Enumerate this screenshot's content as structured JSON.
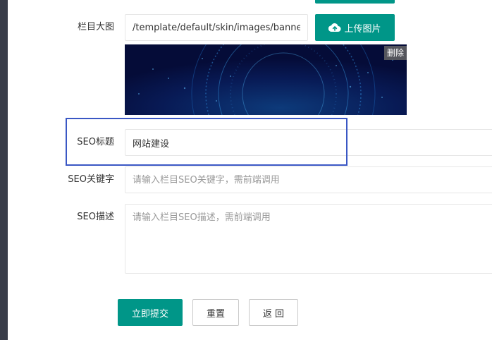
{
  "form": {
    "banner": {
      "label": "栏目大图",
      "value": "/template/default/skin/images/banner.jpg",
      "upload_label": "上传图片",
      "delete_label": "删除"
    },
    "seo_title": {
      "label": "SEO标题",
      "value": "网站建设"
    },
    "seo_keywords": {
      "label": "SEO关键字",
      "placeholder": "请输入栏目SEO关键字，需前端调用"
    },
    "seo_description": {
      "label": "SEO描述",
      "placeholder": "请输入栏目SEO描述，需前端调用"
    }
  },
  "actions": {
    "submit_label": "立即提交",
    "reset_label": "重置",
    "back_label": "返 回"
  },
  "colors": {
    "primary": "#009688",
    "highlight": "#3a57c4",
    "sidebar": "#393D49"
  },
  "icons": {
    "upload": "cloud-upload-icon"
  }
}
